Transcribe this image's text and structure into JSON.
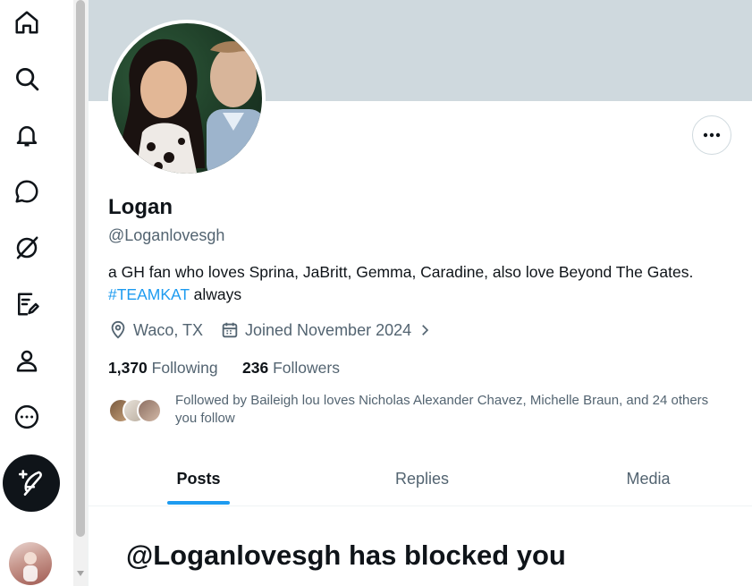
{
  "nav": {
    "items": [
      {
        "icon": "home-icon"
      },
      {
        "icon": "search-icon"
      },
      {
        "icon": "notifications-icon"
      },
      {
        "icon": "messages-icon"
      },
      {
        "icon": "grok-icon"
      },
      {
        "icon": "drafts-icon"
      },
      {
        "icon": "profile-icon"
      },
      {
        "icon": "more-icon"
      }
    ],
    "compose_icon": "compose-feather-icon"
  },
  "profile": {
    "name": "Logan",
    "handle": "@Loganlovesgh",
    "bio_text": "a GH fan who loves Sprina, JaBritt, Gemma, Caradine, also love Beyond The Gates.",
    "bio_hashtag": "#TEAMKAT",
    "bio_suffix": " always",
    "location": "Waco, TX",
    "joined": "Joined November 2024",
    "following_count": "1,370",
    "following_label": "Following",
    "followers_count": "236",
    "followers_label": "Followers",
    "followed_by": "Followed by Baileigh lou loves Nicholas Alexander Chavez, Michelle Braun, and 24 others you follow"
  },
  "tabs": [
    {
      "label": "Posts",
      "active": true
    },
    {
      "label": "Replies",
      "active": false
    },
    {
      "label": "Media",
      "active": false
    }
  ],
  "blocked_message": "@Loganlovesgh has blocked you",
  "colors": {
    "accent": "#1d9bf0",
    "banner": "#cfd9de",
    "text_primary": "#0f1419",
    "text_secondary": "#536471"
  }
}
